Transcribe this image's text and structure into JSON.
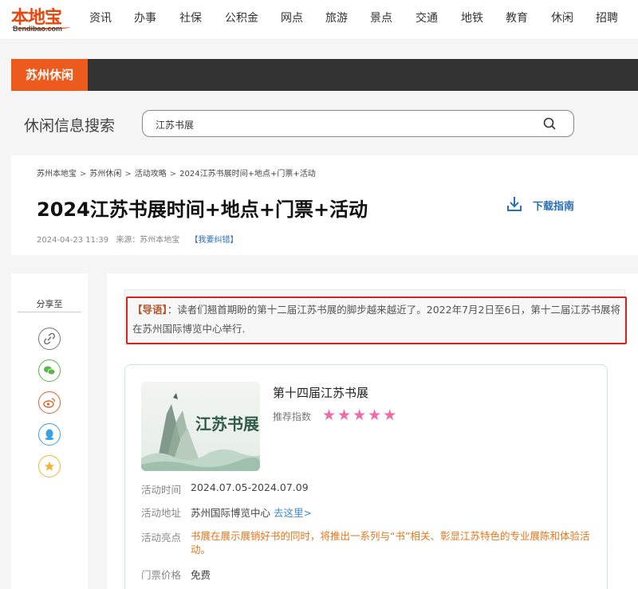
{
  "logo": {
    "main": "本地宝",
    "sub": "Bendibao.com"
  },
  "nav": [
    "资讯",
    "办事",
    "社保",
    "公积金",
    "网点",
    "旅游",
    "景点",
    "交通",
    "地铁",
    "教育",
    "休闲",
    "招聘"
  ],
  "section": {
    "tab": "苏州休闲"
  },
  "search": {
    "label": "休闲信息搜索",
    "value": "江苏书展"
  },
  "breadcrumb": [
    "苏州本地宝",
    "苏州休闲",
    "活动攻略",
    "2024江苏书展时间+地点+门票+活动"
  ],
  "article": {
    "title": "2024江苏书展时间+地点+门票+活动",
    "download_label": "下载指南",
    "date": "2024-04-23 11:39",
    "source": "来源：苏州本地宝",
    "report": "【我要纠错】"
  },
  "share": {
    "title": "分享至",
    "buttons": [
      "link-icon",
      "wechat-icon",
      "weibo-icon",
      "qq-icon",
      "qzone-icon"
    ]
  },
  "intro": {
    "label": "【导语】",
    "text": "：读者们翘首期盼的第十二届江苏书展的脚步越来越近了。2022年7月2日至6日，第十二届江苏书展将在苏州国际博览中心举行."
  },
  "event": {
    "image_text": "江苏书展",
    "name": "第十四届江苏书展",
    "rating_label": "推荐指数",
    "rating": 5,
    "rating_max": 5,
    "time_key": "活动时间",
    "time_val": "2024.07.05-2024.07.09",
    "place_key": "活动地址",
    "place_val": "苏州国际博览中心",
    "place_link": "去这里>",
    "highlight_key": "活动亮点",
    "highlight_val": "书展在展示展销好书的同时，将推出一系列与“书”相关、彰显江苏特色的专业展陈和体验活动。",
    "price_key": "门票价格",
    "price_val": "免费"
  },
  "colors": {
    "accent": "#ec5b1d",
    "link": "#2c6fb5",
    "highlight_border": "#d9221b",
    "star": "#f06aa6"
  }
}
